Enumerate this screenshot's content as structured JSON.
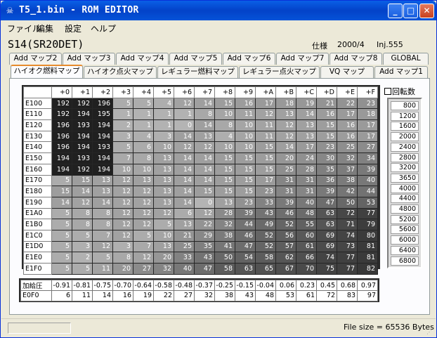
{
  "window": {
    "title": "T5_1.bin - ROM EDITOR",
    "minimize": "_",
    "maximize": "□",
    "close": "✕"
  },
  "menu": [
    "ファイル",
    "編集",
    "設定",
    "ヘルプ"
  ],
  "header": {
    "model": "S14(SR20DET)",
    "spec_label": "仕様",
    "date": "2000/4",
    "inj": "Inj.555"
  },
  "tabs_top": [
    "Add マップ2",
    "Add マップ3",
    "Add マップ4",
    "Add マップ5",
    "Add マップ6",
    "Add マップ7",
    "Add マップ8",
    "GLOBAL"
  ],
  "tabs_bottom": [
    "ハイオク燃料マップ",
    "ハイオク点火マップ",
    "レギュラー燃料マップ",
    "レギュラー点火マップ",
    "VQ マップ",
    "Add マップ1"
  ],
  "active_tab": "ハイオク燃料マップ",
  "map": {
    "col_headers": [
      "+0",
      "+1",
      "+2",
      "+3",
      "+4",
      "+5",
      "+6",
      "+7",
      "+8",
      "+9",
      "+A",
      "+B",
      "+C",
      "+D",
      "+E",
      "+F"
    ],
    "rows": [
      {
        "addr": "E100",
        "vals": [
          192,
          192,
          196,
          5,
          5,
          4,
          12,
          14,
          15,
          16,
          17,
          18,
          19,
          21,
          22,
          23
        ]
      },
      {
        "addr": "E110",
        "vals": [
          192,
          194,
          195,
          1,
          1,
          1,
          1,
          8,
          10,
          11,
          12,
          13,
          14,
          16,
          17,
          18
        ]
      },
      {
        "addr": "E120",
        "vals": [
          196,
          193,
          194,
          2,
          1,
          1,
          0,
          14,
          8,
          10,
          11,
          12,
          13,
          15,
          16,
          17
        ]
      },
      {
        "addr": "E130",
        "vals": [
          196,
          194,
          194,
          3,
          4,
          3,
          14,
          13,
          4,
          10,
          11,
          12,
          13,
          15,
          16,
          17
        ]
      },
      {
        "addr": "E140",
        "vals": [
          196,
          194,
          193,
          5,
          6,
          10,
          12,
          12,
          10,
          10,
          15,
          14,
          17,
          23,
          25,
          27
        ]
      },
      {
        "addr": "E150",
        "vals": [
          194,
          193,
          194,
          7,
          8,
          13,
          14,
          14,
          15,
          15,
          15,
          20,
          24,
          30,
          32,
          34
        ]
      },
      {
        "addr": "E160",
        "vals": [
          194,
          192,
          194,
          10,
          10,
          13,
          14,
          14,
          15,
          15,
          15,
          25,
          28,
          35,
          37,
          39
        ]
      },
      {
        "addr": "E170",
        "vals": [
          5,
          15,
          13,
          12,
          13,
          13,
          14,
          14,
          15,
          15,
          17,
          31,
          31,
          36,
          38,
          40
        ]
      },
      {
        "addr": "E180",
        "vals": [
          15,
          14,
          13,
          12,
          12,
          13,
          14,
          15,
          15,
          15,
          23,
          31,
          31,
          39,
          42,
          44
        ]
      },
      {
        "addr": "E190",
        "vals": [
          14,
          12,
          14,
          12,
          12,
          13,
          14,
          0,
          13,
          23,
          33,
          39,
          40,
          47,
          50,
          53
        ]
      },
      {
        "addr": "E1A0",
        "vals": [
          5,
          8,
          8,
          12,
          12,
          12,
          6,
          12,
          28,
          39,
          43,
          46,
          48,
          63,
          72,
          77
        ]
      },
      {
        "addr": "E1B0",
        "vals": [
          5,
          8,
          8,
          12,
          12,
          5,
          13,
          22,
          32,
          44,
          49,
          52,
          55,
          63,
          71,
          79
        ]
      },
      {
        "addr": "E1C0",
        "vals": [
          5,
          5,
          7,
          12,
          5,
          10,
          21,
          29,
          38,
          46,
          52,
          56,
          60,
          69,
          74,
          80
        ]
      },
      {
        "addr": "E1D0",
        "vals": [
          5,
          3,
          12,
          3,
          7,
          13,
          25,
          35,
          41,
          47,
          52,
          57,
          61,
          69,
          73,
          81
        ]
      },
      {
        "addr": "E1E0",
        "vals": [
          5,
          2,
          5,
          8,
          12,
          20,
          33,
          43,
          50,
          54,
          58,
          62,
          66,
          74,
          77,
          81
        ]
      },
      {
        "addr": "E1F0",
        "vals": [
          5,
          5,
          11,
          20,
          27,
          32,
          40,
          47,
          58,
          63,
          65,
          67,
          70,
          75,
          77,
          82
        ]
      }
    ]
  },
  "rpm": {
    "title": "回転数",
    "values": [
      800,
      1200,
      1600,
      2000,
      2400,
      2800,
      3200,
      3650,
      4000,
      4400,
      4800,
      5200,
      5600,
      6000,
      6400,
      6800
    ]
  },
  "boost": {
    "label": "加給圧",
    "values": [
      "-0.91",
      "-0.81",
      "-0.75",
      "-0.70",
      "-0.64",
      "-0.58",
      "-0.48",
      "-0.37",
      "-0.25",
      "-0.15",
      "-0.04",
      "0.06",
      "0.23",
      "0.45",
      "0.68",
      "0.97"
    ],
    "row_addr": "E0F0",
    "row_vals": [
      6,
      11,
      14,
      16,
      19,
      22,
      27,
      32,
      38,
      43,
      48,
      53,
      61,
      72,
      83,
      97
    ]
  },
  "status": {
    "file_size": "File size =  65536 Bytes"
  }
}
